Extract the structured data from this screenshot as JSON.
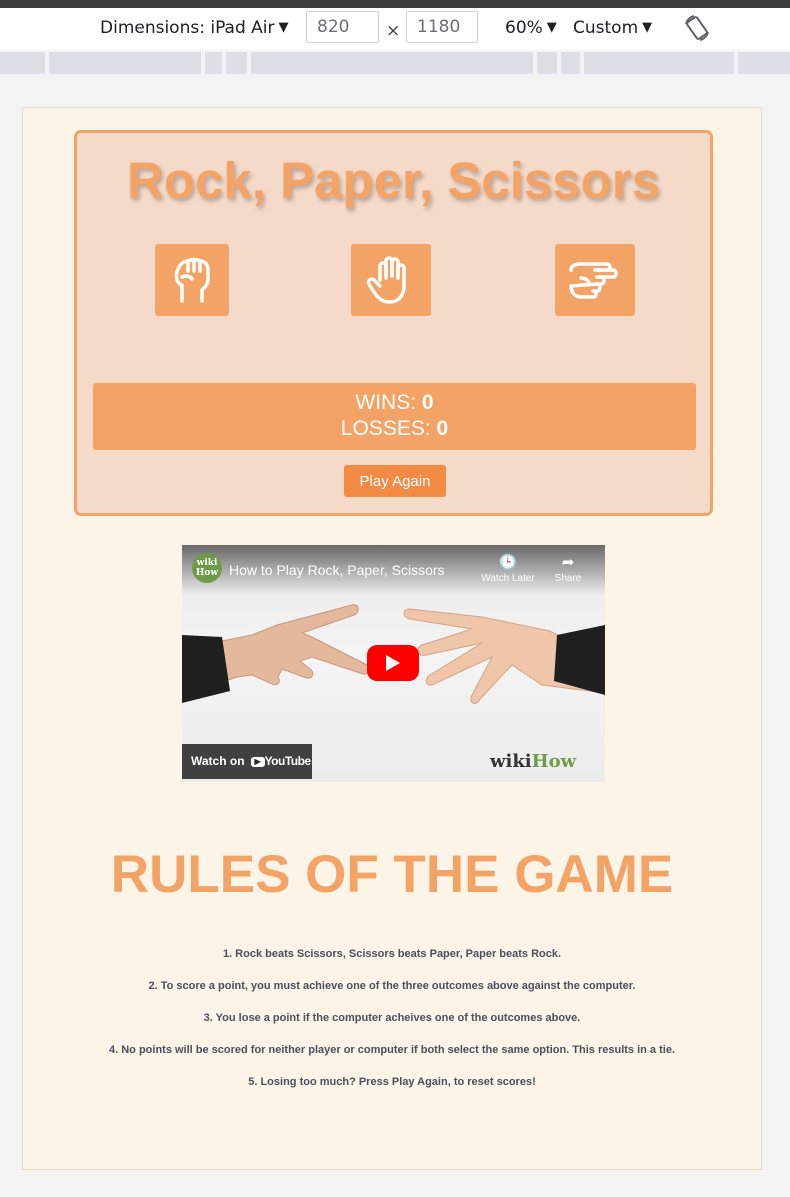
{
  "devtools": {
    "dimensions_label": "Dimensions: iPad Air",
    "width_value": "820",
    "times_sign": "×",
    "height_value": "1180",
    "zoom_label": "60%",
    "throttle_label": "Custom",
    "rotate_icon": "rotate-icon"
  },
  "game": {
    "title": "Rock, Paper, Scissors",
    "choices": [
      {
        "name": "rock",
        "icon": "hand-rock-icon"
      },
      {
        "name": "paper",
        "icon": "hand-paper-icon"
      },
      {
        "name": "scissors",
        "icon": "hand-scissors-icon"
      }
    ],
    "wins_label": "WINS: ",
    "wins_value": "0",
    "losses_label": "LOSSES: ",
    "losses_value": "0",
    "play_again_label": "Play Again"
  },
  "video": {
    "channel_logo_text": "wiki How",
    "title": "How to Play Rock, Paper, Scissors",
    "watch_later_label": "Watch Later",
    "share_label": "Share",
    "watch_on_label": "Watch on",
    "youtube_label": "YouTube",
    "watermark_prefix": "wiki",
    "watermark_suffix": "How"
  },
  "rules": {
    "title": "RULES OF THE GAME",
    "items": [
      "1. Rock beats Scissors, Scissors beats Paper, Paper beats Rock.",
      "2. To score a point, you must achieve one of the three outcomes above against the computer.",
      "3. You lose a point if the computer acheives one of the outcomes above.",
      "4. No points will be scored for neither player or computer if both select the same option. This results in a tie.",
      "5. Losing too much? Press Play Again, to reset scores!"
    ]
  },
  "colors": {
    "accent": "#f2a365",
    "button": "#f38b45",
    "card_bg": "#f5dac9",
    "page_bg": "#fdf4e8",
    "text_dark": "#4a4f5c"
  }
}
